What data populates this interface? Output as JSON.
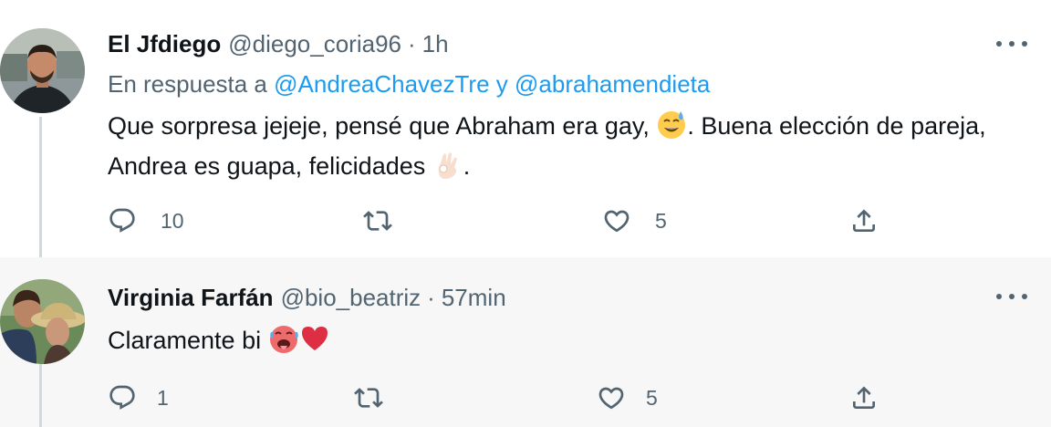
{
  "tweets": [
    {
      "display_name": "El Jfdiego",
      "handle": "@diego_coria96",
      "separator": "·",
      "time": "1h",
      "reply_prefix": "En respuesta a",
      "reply_mention_1": "@AndreaChavezTre",
      "reply_conjunction": "y",
      "reply_mention_2": "@abrahamendieta",
      "text_part1": "Que sorpresa jejeje, pensé que Abraham era gay,",
      "text_part2": ". Buena elección de pareja, Andrea es guapa, felicidades",
      "text_part3": ".",
      "emoji_1": "sweat-smile-emoji",
      "emoji_2": "ok-hand-emoji",
      "replies": "10",
      "retweets": "",
      "likes": "5"
    },
    {
      "display_name": "Virginia Farfán",
      "handle": "@bio_beatriz",
      "separator": "·",
      "time": "57min",
      "text": "Claramente bi",
      "emoji_1": "hot-face-emoji",
      "emoji_2": "red-heart-emoji",
      "replies": "1",
      "retweets": "",
      "likes": "5"
    }
  ],
  "colors": {
    "link": "#1d9bf0",
    "secondary_text": "#536471",
    "primary_text": "#0f1419",
    "thread_line": "#cfd9de",
    "highlight_bg": "#f7f7f7"
  }
}
